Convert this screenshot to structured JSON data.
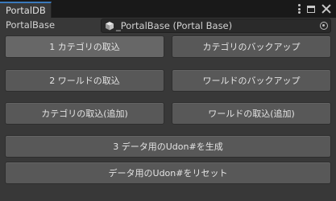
{
  "window": {
    "tab_title": "PortalDB"
  },
  "field": {
    "label": "PortalBase",
    "value": "_PortalBase (Portal Base)",
    "icon": "cube-icon"
  },
  "buttons": {
    "import_categories": "1 カテゴリの取込",
    "backup_categories": "カテゴリのバックアップ",
    "import_worlds": "2 ワールドの取込",
    "backup_worlds": "ワールドのバックアップ",
    "import_categories_append": "カテゴリの取込(追加)",
    "import_worlds_append": "ワールドの取込(追加)",
    "generate_udon": "3 データ用のUdon#を生成",
    "reset_udon": "データ用のUdon#をリセット"
  },
  "colors": {
    "background": "#383838",
    "button": "#585858",
    "tab_accent": "#3a79bb"
  }
}
